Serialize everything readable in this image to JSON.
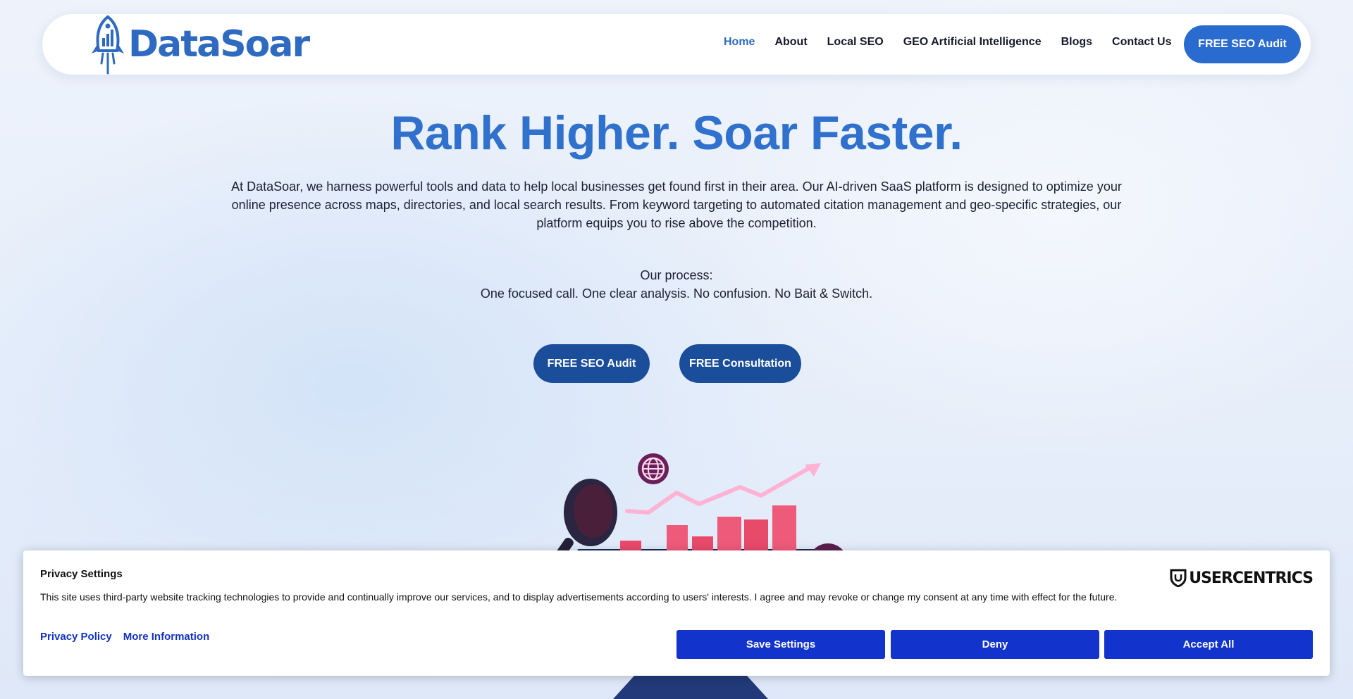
{
  "header": {
    "logo_text": "DataSoar",
    "nav": [
      {
        "label": "Home",
        "active": true
      },
      {
        "label": "About"
      },
      {
        "label": "Local SEO"
      },
      {
        "label": "GEO Artificial Intelligence"
      },
      {
        "label": "Blogs"
      },
      {
        "label": "Contact Us"
      }
    ],
    "cta_label": "FREE SEO Audit"
  },
  "hero": {
    "title": "Rank Higher. Soar Faster.",
    "description": "At DataSoar, we harness powerful tools and data to help local businesses get found first in their area. Our AI-driven SaaS platform is designed to optimize your online presence across maps, directories, and local search results. From keyword targeting to automated citation management and geo-specific strategies, our platform equips you to rise above the competition.",
    "process_heading": "Our process:",
    "process_text": "One focused call. One clear analysis. No confusion. No Bait & Switch.",
    "buttons": {
      "audit": "FREE SEO Audit",
      "consultation": "FREE Consultation"
    }
  },
  "consent": {
    "title": "Privacy Settings",
    "text": "This site uses third-party website tracking technologies to provide and continually improve our services, and to display advertisements according to users' interests. I agree and may revoke or change my consent at any time with effect for the future.",
    "links": {
      "privacy_policy": "Privacy Policy",
      "more_info": "More Information"
    },
    "brand": "USERCENTRICS",
    "buttons": {
      "save": "Save Settings",
      "deny": "Deny",
      "accept": "Accept All"
    }
  },
  "colors": {
    "brand_blue": "#2f71cc",
    "button_dark_blue": "#1a4e9a",
    "consent_blue": "#1233cc"
  }
}
